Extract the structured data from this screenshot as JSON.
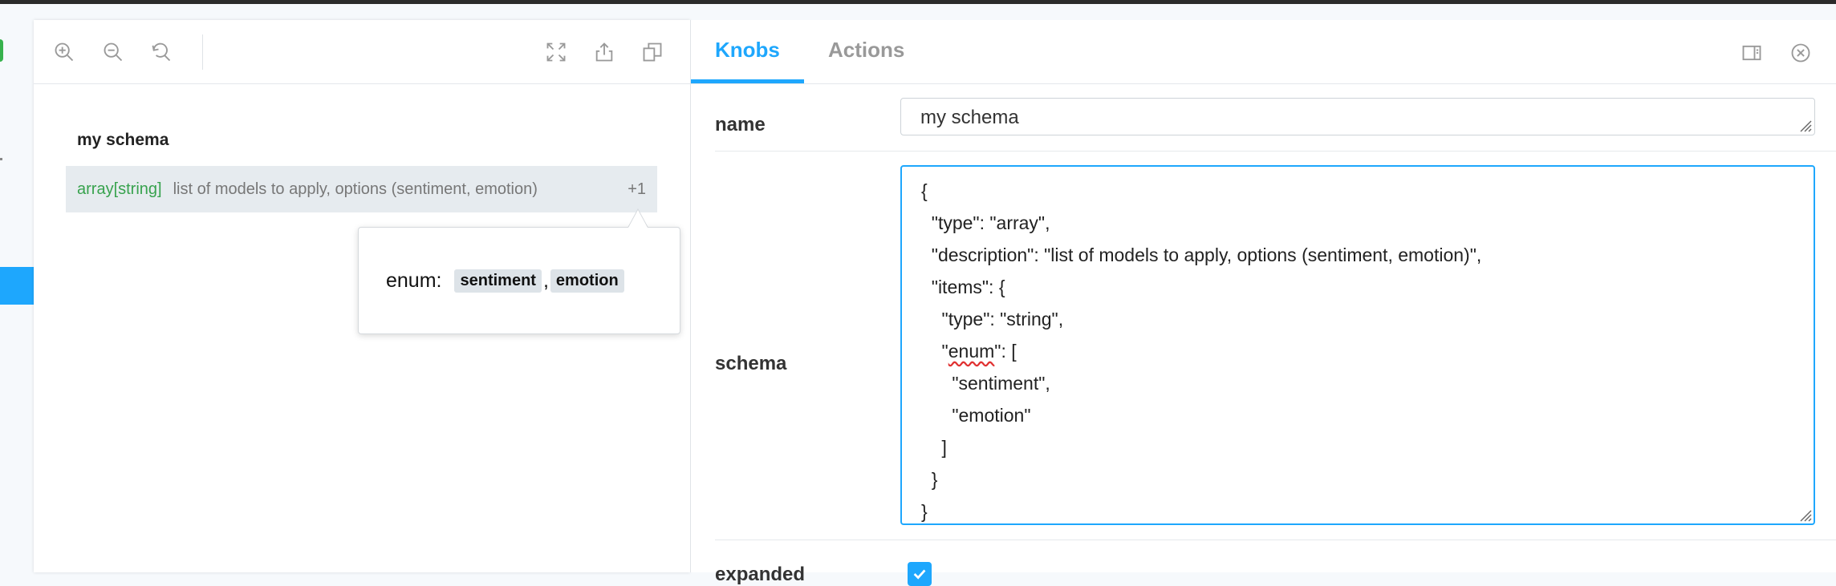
{
  "preview": {
    "schema_title": "my schema",
    "row": {
      "type": "array[string]",
      "description": "list of models to apply, options (sentiment, emotion)",
      "more": "+1"
    },
    "popover": {
      "key": "enum:",
      "values": [
        "sentiment",
        "emotion"
      ],
      "separator": ","
    }
  },
  "addons": {
    "tabs": [
      {
        "label": "Knobs",
        "active": true
      },
      {
        "label": "Actions",
        "active": false
      }
    ],
    "knobs": {
      "name_label": "name",
      "name_value": "my schema",
      "schema_label": "schema",
      "schema_lines": [
        "{",
        "  \"type\": \"array\",",
        "  \"description\": \"list of models to apply, options (sentiment, emotion)\",",
        "  \"items\": {",
        "    \"type\": \"string\",",
        "    \"enum\": [",
        "      \"sentiment\",",
        "      \"emotion\"",
        "    ]",
        "  }",
        "}"
      ],
      "expanded_label": "expanded",
      "expanded_checked": true
    }
  },
  "colors": {
    "accent": "#1ea7fd",
    "type_green": "#37a24d"
  }
}
